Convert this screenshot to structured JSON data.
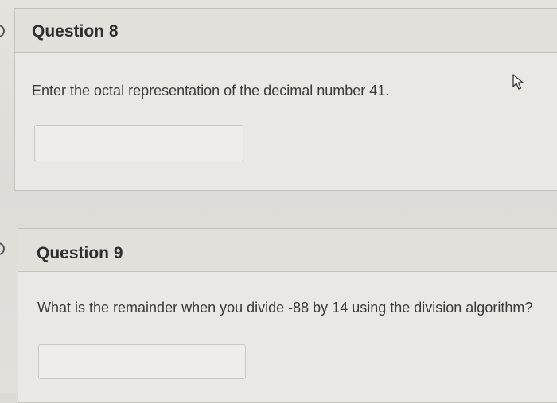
{
  "questions": [
    {
      "title": "Question 8",
      "prompt": "Enter the octal representation of the decimal number 41.",
      "answer_value": ""
    },
    {
      "title": "Question 9",
      "prompt": "What is the remainder when you divide -88 by 14 using the division algorithm?",
      "answer_value": ""
    }
  ],
  "icons": {
    "nav_marker": "chevron-right-icon",
    "pointer": "mouse-cursor-icon"
  },
  "colors": {
    "page_background": "#dcdbd6",
    "card_background": "#e9e8e4",
    "header_background": "#e1e0db",
    "title_text": "#2f2f2f",
    "body_text": "#3a3a3a",
    "border": "#c4c3be"
  }
}
